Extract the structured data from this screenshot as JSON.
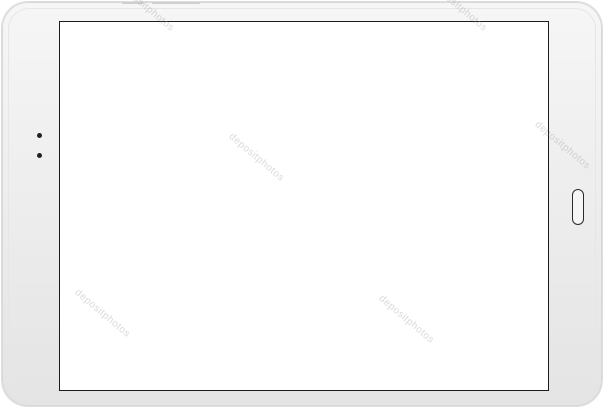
{
  "device": {
    "type": "tablet",
    "orientation": "landscape",
    "frame_color": "#eeeeee",
    "screen_color": "#ffffff",
    "screen_border_color": "#1c1c1c"
  },
  "watermark": {
    "text": "depositphotos"
  },
  "icons": {
    "camera": "front-camera-icon",
    "sensor": "light-sensor-icon",
    "home": "home-button-icon"
  }
}
